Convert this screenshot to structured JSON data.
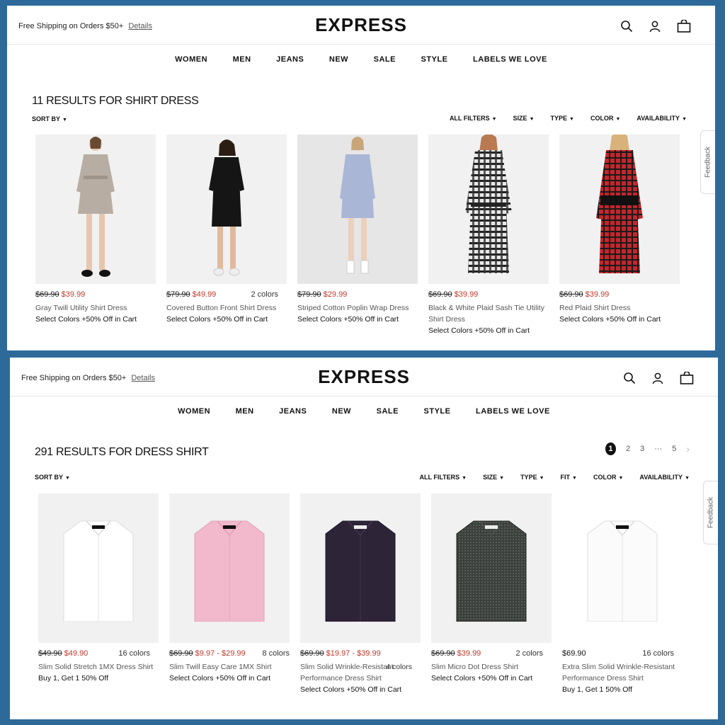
{
  "header": {
    "promo_text": "Free Shipping on Orders $50+",
    "promo_link": "Details",
    "logo": "EXPRESS"
  },
  "nav": [
    "WOMEN",
    "MEN",
    "JEANS",
    "NEW",
    "SALE",
    "STYLE",
    "LABELS WE LOVE"
  ],
  "feedback_label": "Feedback",
  "sort_by": "SORT BY",
  "top": {
    "results_title": "11 RESULTS FOR SHIRT DRESS",
    "filters": [
      "ALL FILTERS",
      "SIZE",
      "TYPE",
      "COLOR",
      "AVAILABILITY"
    ],
    "products": [
      {
        "orig": "$69.90",
        "sale": "$39.99",
        "colors": "",
        "name": "Gray Twill Utility Shirt Dress",
        "promo": "Select Colors +50% Off in Cart",
        "color": "#b8ada3"
      },
      {
        "orig": "$79.90",
        "sale": "$49.99",
        "colors": "2 colors",
        "name": "Covered Button Front Shirt Dress",
        "promo": "Select Colors +50% Off in Cart",
        "color": "#151515"
      },
      {
        "orig": "$79.90",
        "sale": "$29.99",
        "colors": "",
        "name": "Striped Cotton Poplin Wrap Dress",
        "promo": "Select Colors +50% Off in Cart",
        "color": "#a9b6d6"
      },
      {
        "orig": "$69.90",
        "sale": "$39.99",
        "colors": "",
        "name": "Black & White Plaid Sash Tie Utility Shirt Dress",
        "promo": "Select Colors +50% Off in Cart",
        "color": "#5a5a5a"
      },
      {
        "orig": "$69.90",
        "sale": "$39.99",
        "colors": "",
        "name": "Red Plaid Shirt Dress",
        "promo": "Select Colors +50% Off in Cart",
        "color": "#c4262c"
      }
    ]
  },
  "bottom": {
    "results_title": "291 RESULTS FOR DRESS SHIRT",
    "filters": [
      "ALL FILTERS",
      "SIZE",
      "TYPE",
      "FIT",
      "COLOR",
      "AVAILABILITY"
    ],
    "pagination": {
      "current": "1",
      "pages": [
        "2",
        "3"
      ],
      "ellipsis": "···",
      "last": "5",
      "next": "›"
    },
    "products": [
      {
        "orig": "$49.90",
        "sale": "$49.90",
        "colors": "16 colors",
        "name": "Slim Solid Stretch 1MX Dress Shirt",
        "promo": "Buy 1, Get 1 50% Off",
        "color": "#ffffff"
      },
      {
        "orig": "$69.90",
        "sale": "$9.97 - $29.99",
        "colors": "8 colors",
        "name": "Slim Twill Easy Care 1MX Shirt",
        "promo": "Select Colors +50% Off in Cart",
        "color": "#f2b8cc"
      },
      {
        "orig": "$69.90",
        "sale": "$19.97 - $39.99",
        "colors": "4 colors",
        "name": "Slim Solid Wrinkle-Resistant Performance Dress Shirt",
        "promo": "Select Colors +50% Off in Cart",
        "color": "#2d2438"
      },
      {
        "orig": "$69.90",
        "sale": "$39.99",
        "colors": "2 colors",
        "name": "Slim Micro Dot Dress Shirt",
        "promo": "Select Colors +50% Off in Cart",
        "color": "#3b403c"
      },
      {
        "orig": "",
        "sale": "",
        "regular": "$69.90",
        "colors": "16 colors",
        "name": "Extra Slim Solid Wrinkle-Resistant Performance Dress Shirt",
        "promo": "Buy 1, Get 1 50% Off",
        "color": "#fbfbfb"
      }
    ]
  }
}
